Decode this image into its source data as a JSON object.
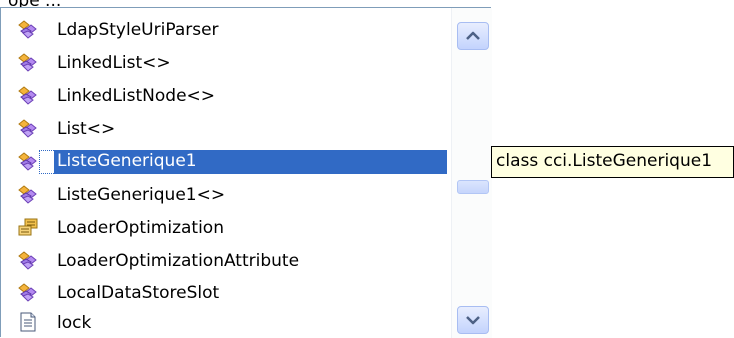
{
  "partial_text": "ope ...",
  "completion_list": {
    "items": [
      {
        "label": "LdapStyleUriParser",
        "icon": "class-icon"
      },
      {
        "label": "LinkedList<>",
        "icon": "class-icon"
      },
      {
        "label": "LinkedListNode<>",
        "icon": "class-icon"
      },
      {
        "label": "List<>",
        "icon": "class-icon"
      },
      {
        "label": "ListeGenerique1",
        "icon": "class-icon"
      },
      {
        "label": "ListeGenerique1<>",
        "icon": "class-icon"
      },
      {
        "label": "LoaderOptimization",
        "icon": "enum-icon"
      },
      {
        "label": "LoaderOptimizationAttribute",
        "icon": "class-icon"
      },
      {
        "label": "LocalDataStoreSlot",
        "icon": "class-icon"
      },
      {
        "label": "lock",
        "icon": "keyword-icon"
      }
    ],
    "selected_item": "ListeGenerique1"
  },
  "scrollbar": {
    "up_icon": "scroll-up-arrow-icon",
    "down_icon": "scroll-down-arrow-icon",
    "position": 0.55
  },
  "tooltip": {
    "text": "class cci.ListeGenerique1"
  },
  "colors": {
    "selection": "#316ac5",
    "tooltip_background": "#ffffe1",
    "list_border": "#7f9db9"
  }
}
